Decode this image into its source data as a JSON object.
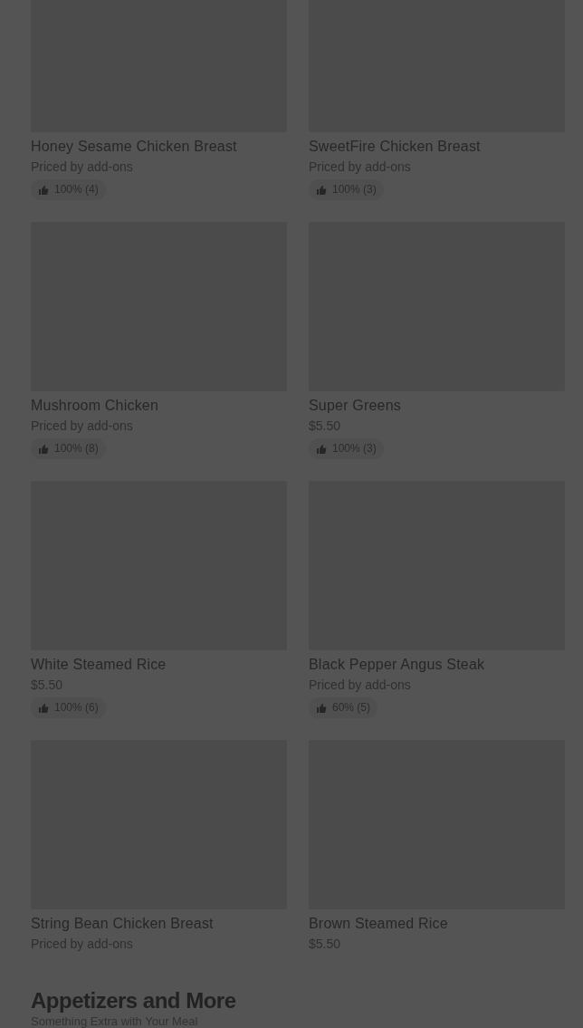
{
  "items": [
    {
      "name": "Honey Sesame Chicken Breast",
      "price": "Priced by add-ons",
      "rating": "100% (4)"
    },
    {
      "name": "SweetFire Chicken Breast",
      "price": "Priced by add-ons",
      "rating": "100% (3)"
    },
    {
      "name": "Mushroom Chicken",
      "price": "Priced by add-ons",
      "rating": "100% (8)"
    },
    {
      "name": "Super Greens",
      "price": "$5.50",
      "rating": "100% (3)"
    },
    {
      "name": "White Steamed Rice",
      "price": "$5.50",
      "rating": "100% (6)"
    },
    {
      "name": "Black Pepper Angus Steak",
      "price": "Priced by add-ons",
      "rating": "60% (5)"
    },
    {
      "name": "String Bean Chicken Breast",
      "price": "Priced by add-ons"
    },
    {
      "name": "Brown Steamed Rice",
      "price": "$5.50"
    }
  ],
  "next_section": {
    "title": "Appetizers and More",
    "subtitle": "Something Extra with Your Meal"
  }
}
